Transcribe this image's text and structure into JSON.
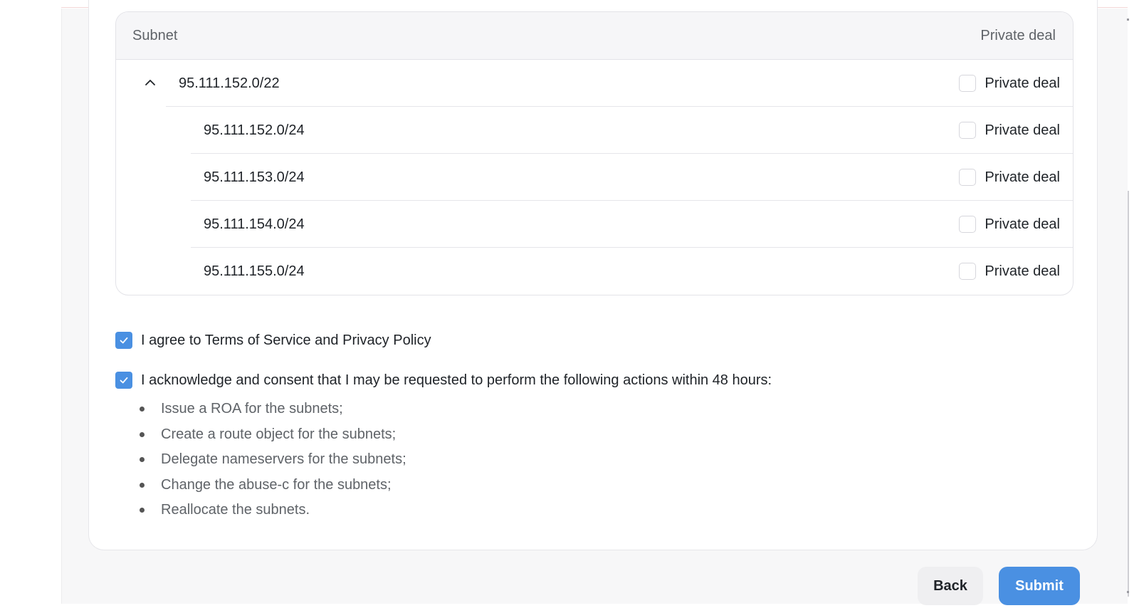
{
  "table": {
    "header": {
      "subnet": "Subnet",
      "private_deal": "Private deal"
    },
    "parent": {
      "subnet": "95.111.152.0/22",
      "private_deal_label": "Private deal",
      "checked": false,
      "expanded": true
    },
    "children": [
      {
        "subnet": "95.111.152.0/24",
        "private_deal_label": "Private deal",
        "checked": false
      },
      {
        "subnet": "95.111.153.0/24",
        "private_deal_label": "Private deal",
        "checked": false
      },
      {
        "subnet": "95.111.154.0/24",
        "private_deal_label": "Private deal",
        "checked": false
      },
      {
        "subnet": "95.111.155.0/24",
        "private_deal_label": "Private deal",
        "checked": false
      }
    ]
  },
  "consents": {
    "terms": {
      "label": "I agree to Terms of Service and Privacy Policy",
      "checked": true
    },
    "acknowledge": {
      "label": "I acknowledge and consent that I may be requested to perform the following actions within 48 hours:",
      "checked": true
    },
    "actions": [
      "Issue a ROA for the subnets;",
      "Create a route object for the subnets;",
      "Delegate nameservers for the subnets;",
      "Change the abuse-c for the subnets;",
      "Reallocate the subnets."
    ]
  },
  "buttons": {
    "back": "Back",
    "submit": "Submit"
  },
  "colors": {
    "accent": "#4a90e2",
    "back_button_bg": "#efeff1",
    "text": "#1f2328",
    "muted_text": "#5f6368"
  }
}
